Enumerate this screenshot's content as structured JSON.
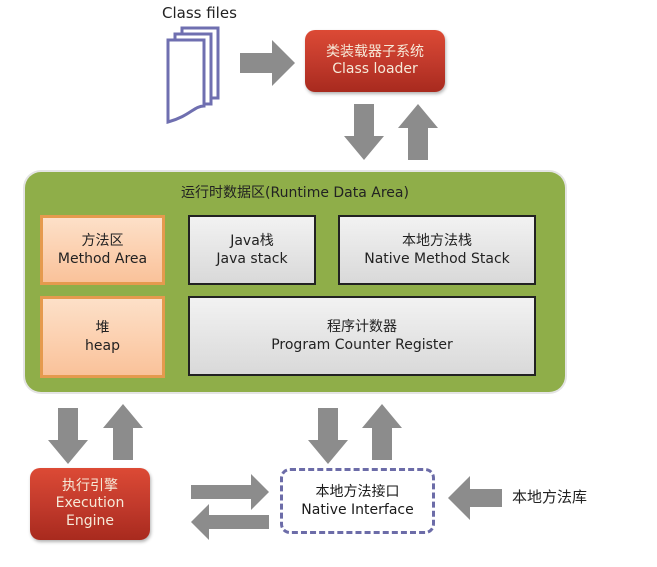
{
  "class_files": {
    "label": "Class files"
  },
  "class_loader": {
    "zh": "类装载器子系统",
    "en": "Class loader"
  },
  "runtime_data_area": {
    "title": "运行时数据区(Runtime Data Area)",
    "method_area": {
      "zh": "方法区",
      "en": "Method Area"
    },
    "java_stack": {
      "zh": "Java栈",
      "en": "Java stack"
    },
    "native_method_stack": {
      "zh": "本地方法栈",
      "en": "Native Method Stack"
    },
    "heap": {
      "zh": "堆",
      "en": "heap"
    },
    "pc_register": {
      "zh": "程序计数器",
      "en": "Program Counter Register"
    }
  },
  "execution_engine": {
    "zh": "执行引擎",
    "en1": "Execution",
    "en2": "Engine"
  },
  "native_interface": {
    "zh": "本地方法接口",
    "en": "Native Interface"
  },
  "native_library": {
    "label": "本地方法库"
  },
  "colors": {
    "red": "#c0392b",
    "green": "#8fae49",
    "orange": "#fac29a",
    "gray": "#d9d9d9",
    "arrow": "#8c8c8c",
    "dashed": "#6c6ca8"
  }
}
